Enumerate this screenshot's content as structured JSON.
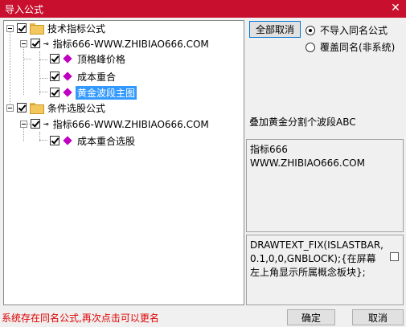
{
  "window": {
    "title": "导入公式",
    "close_glyph": "✕"
  },
  "tree": {
    "root1": {
      "label": "技术指标公式"
    },
    "group1": {
      "label": "指标666-WWW.ZHIBIAO666.COM"
    },
    "items1": [
      "顶格峰价格",
      "成本重合",
      "黄金波段主图"
    ],
    "root2": {
      "label": "条件选股公式"
    },
    "group2": {
      "label": "指标666-WWW.ZHIBIAO666.COM"
    },
    "items2": [
      "成本重合选股"
    ],
    "selected": "黄金波段主图"
  },
  "buttons": {
    "cancel_all": "全部取消",
    "ok": "确定",
    "cancel": "取消"
  },
  "options": {
    "no_import": "不导入同名公式",
    "overwrite": "覆盖同名(非系统)",
    "selected": "不导入同名公式"
  },
  "description": "叠加黄金分割个波段ABC",
  "panel_name": "指标666\nWWW.ZHIBIAO666.COM",
  "panel_code": "DRAWTEXT_FIX(ISLASTBAR,0.1,0,0,GNBLOCK);{在屏幕左上角显示所属概念板块};",
  "status": "系统存在同名公式,再次点击可以更名"
}
